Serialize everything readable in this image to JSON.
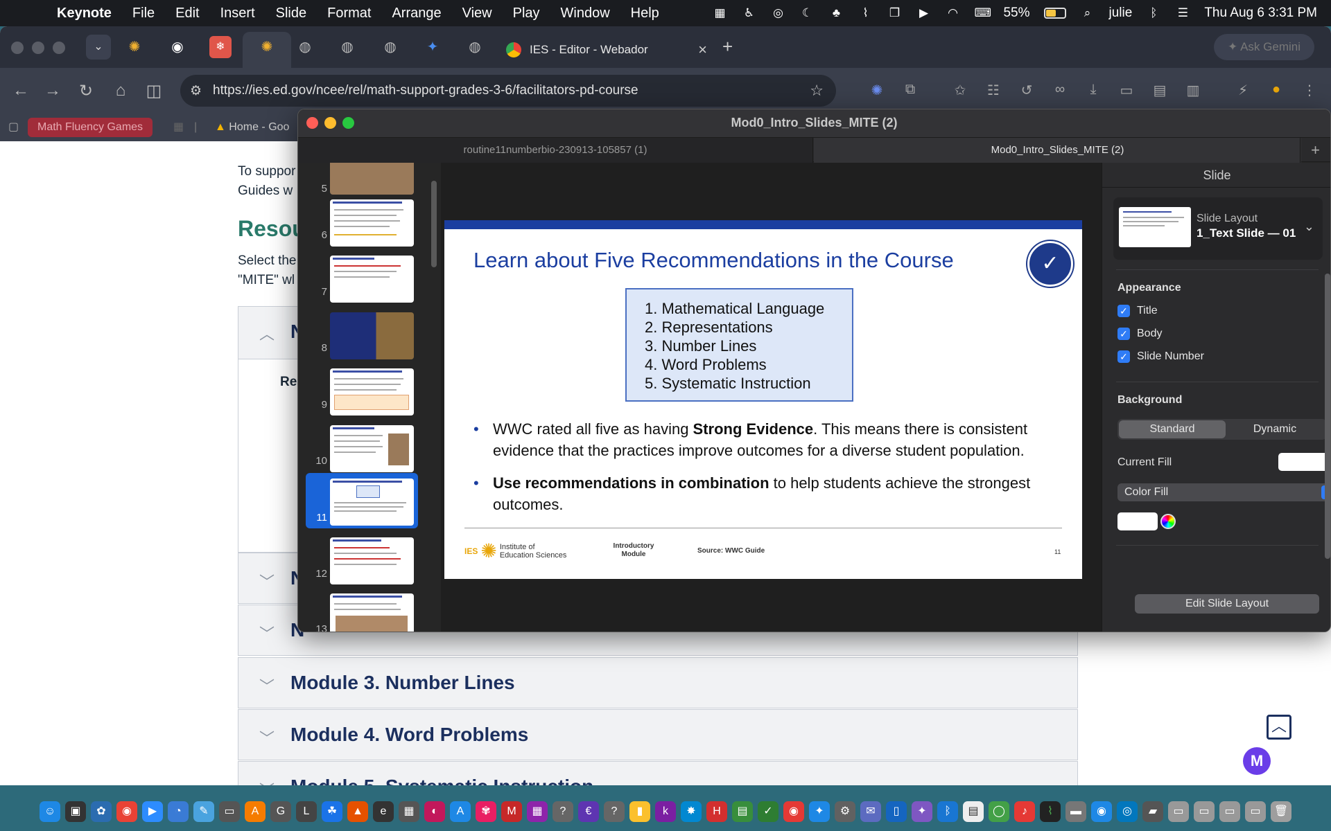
{
  "menubar": {
    "app_name": "Keynote",
    "menus": [
      "File",
      "Edit",
      "Insert",
      "Slide",
      "Format",
      "Arrange",
      "View",
      "Play",
      "Window",
      "Help"
    ],
    "battery_percent": "55%",
    "battery_level": 0.55,
    "user": "julie",
    "datetime": "Thu Aug 6  3:31 PM"
  },
  "browser": {
    "active_tab_title": "IES - Editor - Webador",
    "gemini_label": "Ask Gemini",
    "url": "https://ies.ed.gov/ncee/rel/math-support-grades-3-6/facilitators-pd-course",
    "bookmarks": [
      "Math Fluency Games",
      "Home - Goo"
    ]
  },
  "webpage": {
    "intro_line1": "To suppor",
    "intro_line2": "Guides w",
    "resources_heading": "Resou",
    "select_line1": "Select the",
    "select_line2": "\"MITE\" wl",
    "panel_fragment_n": "N",
    "panel_fragment_re": "Re",
    "row1_fragment": "N",
    "row2_fragment": "N",
    "modules": [
      {
        "label": "Module 3. Number Lines"
      },
      {
        "label": "Module 4. Word Problems"
      },
      {
        "label": "Module 5. Systematic Instruction"
      }
    ],
    "float_button_letter": "M"
  },
  "keynote": {
    "window_title": "Mod0_Intro_Slides_MITE (2)",
    "tabs": [
      "routine11numberbio-230913-105857 (1)",
      "Mod0_Intro_Slides_MITE (2)"
    ],
    "navigator": {
      "slide_numbers": [
        "5",
        "6",
        "7",
        "8",
        "9",
        "10",
        "11",
        "12",
        "13"
      ],
      "selected": "11"
    },
    "slide": {
      "title": "Learn about Five Recommendations in the Course",
      "recommendations": [
        "1.  Mathematical Language",
        "2.  Representations",
        "3.  Number Lines",
        "4.  Word Problems",
        "5.  Systematic Instruction"
      ],
      "bullet1_pre": "WWC rated all five as having ",
      "bullet1_bold": "Strong Evidence",
      "bullet1_post": ". This means there is consistent evidence that the practices improve outcomes for a diverse student population.",
      "bullet2_bold": "Use recommendations in combination",
      "bullet2_post": " to help students achieve the strongest outcomes.",
      "footer_org_abbr": "IES",
      "footer_org_line1": "Institute of",
      "footer_org_line2": "Education Sciences",
      "footer_module_line1": "Introductory",
      "footer_module_line2": "Module",
      "footer_source": "Source: WWC Guide",
      "page_number": "11"
    },
    "inspector": {
      "header": "Slide",
      "layout_label": "Slide Layout",
      "layout_value": "1_Text Slide — 01",
      "appearance_label": "Appearance",
      "checkboxes": [
        {
          "label": "Title",
          "checked": true
        },
        {
          "label": "Body",
          "checked": true
        },
        {
          "label": "Slide Number",
          "checked": true
        }
      ],
      "background_label": "Background",
      "segment_standard": "Standard",
      "segment_dynamic": "Dynamic",
      "current_fill_label": "Current Fill",
      "fill_type": "Color Fill",
      "edit_layout_button": "Edit Slide Layout"
    }
  },
  "colors": {
    "slide_title_blue": "#1b3ea0",
    "module_heading_navy": "#1b2f5e",
    "resources_teal": "#2a7a6a",
    "selection_blue": "#1a64d8"
  }
}
